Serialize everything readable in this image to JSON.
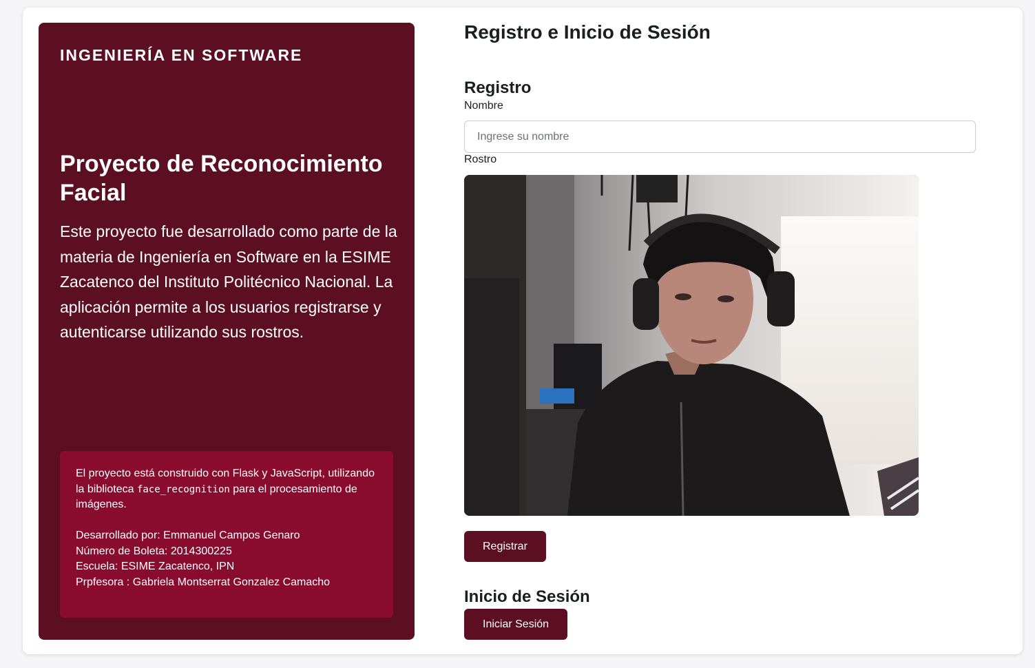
{
  "sidebar": {
    "brand": "INGENIERÍA EN SOFTWARE",
    "title": "Proyecto de Reconocimiento Facial",
    "description": "Este proyecto fue desarrollado como parte de la materia de Ingeniería en Software en la ESIME Zacatenco del Instituto Politécnico Nacional. La aplicación permite a los usuarios registrarse y autenticarse utilizando sus rostros.",
    "info": {
      "tech_before": "El proyecto está construido con Flask y JavaScript, utilizando la biblioteca ",
      "tech_code": "face_recognition",
      "tech_after": " para el procesamiento de imágenes.",
      "developer": "Desarrollado por: Emmanuel Campos Genaro",
      "boleta": "Número de Boleta: 2014300225",
      "school": "Escuela: ESIME Zacatenco, IPN",
      "teacher": "Prpfesora : Gabriela Montserrat Gonzalez Camacho"
    }
  },
  "main": {
    "title": "Registro e Inicio de Sesión",
    "register": {
      "heading": "Registro",
      "name_label": "Nombre",
      "name_placeholder": "Ingrese su nombre",
      "name_value": "",
      "face_label": "Rostro",
      "button": "Registrar"
    },
    "login": {
      "heading": "Inicio de Sesión",
      "button": "Iniciar Sesión"
    }
  },
  "colors": {
    "sidebar_bg": "#5c0f22",
    "info_box_bg": "#890c2e",
    "button_bg": "#5c0f22"
  }
}
